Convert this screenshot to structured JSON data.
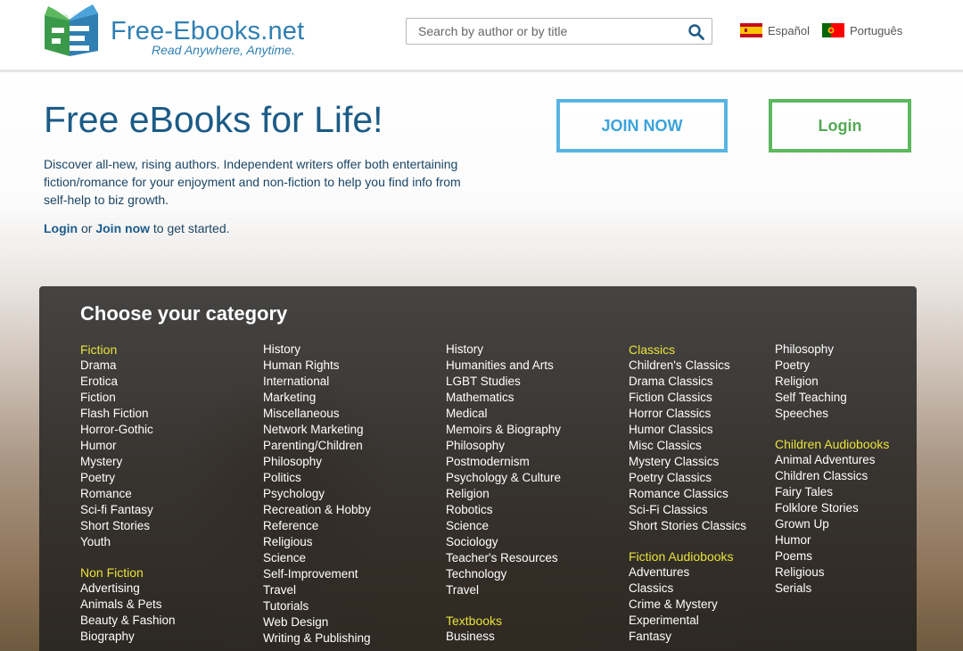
{
  "header": {
    "logo_name": "Free-Ebooks.net",
    "logo_tagline": "Read Anywhere, Anytime.",
    "search_placeholder": "Search by author or by title",
    "languages": [
      "Español",
      "Português"
    ]
  },
  "hero": {
    "title": "Free eBooks for Life!",
    "description": "Discover all-new, rising authors. Independent writers offer both entertaining fiction/romance for your enjoyment and non-fiction to help you find info from self-help to biz growth.",
    "cta_login": "Login",
    "cta_or": " or ",
    "cta_join": "Join now",
    "cta_rest": " to get started.",
    "join_button": "JOIN NOW",
    "login_button": "Login"
  },
  "categories": {
    "title": "Choose your category",
    "col1": [
      {
        "label": "Fiction",
        "head": true
      },
      {
        "label": "Drama"
      },
      {
        "label": "Erotica"
      },
      {
        "label": "Fiction"
      },
      {
        "label": "Flash Fiction"
      },
      {
        "label": "Horror-Gothic"
      },
      {
        "label": "Humor"
      },
      {
        "label": "Mystery"
      },
      {
        "label": "Poetry"
      },
      {
        "label": "Romance"
      },
      {
        "label": "Sci-fi Fantasy"
      },
      {
        "label": "Short Stories"
      },
      {
        "label": "Youth"
      },
      {
        "label": "Non Fiction",
        "head": true
      },
      {
        "label": "Advertising"
      },
      {
        "label": "Animals & Pets"
      },
      {
        "label": "Beauty & Fashion"
      },
      {
        "label": "Biography"
      }
    ],
    "col2": [
      {
        "label": "History"
      },
      {
        "label": "Human Rights"
      },
      {
        "label": "International"
      },
      {
        "label": "Marketing"
      },
      {
        "label": "Miscellaneous"
      },
      {
        "label": "Network Marketing"
      },
      {
        "label": "Parenting/Children"
      },
      {
        "label": "Philosophy"
      },
      {
        "label": "Politics"
      },
      {
        "label": "Psychology"
      },
      {
        "label": "Recreation & Hobby"
      },
      {
        "label": "Reference"
      },
      {
        "label": "Religious"
      },
      {
        "label": "Science"
      },
      {
        "label": "Self-Improvement"
      },
      {
        "label": "Travel"
      },
      {
        "label": "Tutorials"
      },
      {
        "label": "Web Design"
      },
      {
        "label": "Writing & Publishing"
      }
    ],
    "col3": [
      {
        "label": "History"
      },
      {
        "label": "Humanities and Arts"
      },
      {
        "label": "LGBT Studies"
      },
      {
        "label": "Mathematics"
      },
      {
        "label": "Medical"
      },
      {
        "label": "Memoirs & Biography"
      },
      {
        "label": "Philosophy"
      },
      {
        "label": "Postmodernism"
      },
      {
        "label": "Psychology & Culture"
      },
      {
        "label": "Religion"
      },
      {
        "label": "Robotics"
      },
      {
        "label": "Science"
      },
      {
        "label": "Sociology"
      },
      {
        "label": "Teacher's Resources"
      },
      {
        "label": "Technology"
      },
      {
        "label": "Travel"
      },
      {
        "label": "Textbooks",
        "head": true
      },
      {
        "label": "Business"
      }
    ],
    "col4": [
      {
        "label": "Classics",
        "head": true
      },
      {
        "label": "Children's Classics"
      },
      {
        "label": "Drama Classics"
      },
      {
        "label": "Fiction Classics"
      },
      {
        "label": "Horror Classics"
      },
      {
        "label": "Humor Classics"
      },
      {
        "label": "Misc Classics"
      },
      {
        "label": "Mystery Classics"
      },
      {
        "label": "Poetry Classics"
      },
      {
        "label": "Romance Classics"
      },
      {
        "label": "Sci-Fi Classics"
      },
      {
        "label": "Short Stories Classics"
      },
      {
        "label": "Fiction Audiobooks",
        "head": true
      },
      {
        "label": "Adventures"
      },
      {
        "label": "Classics"
      },
      {
        "label": "Crime & Mystery"
      },
      {
        "label": "Experimental"
      },
      {
        "label": "Fantasy"
      }
    ],
    "col5": [
      {
        "label": "Philosophy"
      },
      {
        "label": "Poetry"
      },
      {
        "label": "Religion"
      },
      {
        "label": "Self Teaching"
      },
      {
        "label": "Speeches"
      },
      {
        "label": "Children Audiobooks",
        "head": true
      },
      {
        "label": "Animal Adventures"
      },
      {
        "label": "Children Classics"
      },
      {
        "label": "Fairy Tales"
      },
      {
        "label": "Folklore Stories"
      },
      {
        "label": "Grown Up"
      },
      {
        "label": "Humor"
      },
      {
        "label": "Poems"
      },
      {
        "label": "Religious"
      },
      {
        "label": "Serials"
      }
    ]
  },
  "colors": {
    "brand_blue": "#2f7fb2",
    "title_blue": "#1c5b86",
    "join_blue": "#5ab4e3",
    "login_green": "#5cb85c",
    "category_head_yellow": "#e7e23b"
  }
}
